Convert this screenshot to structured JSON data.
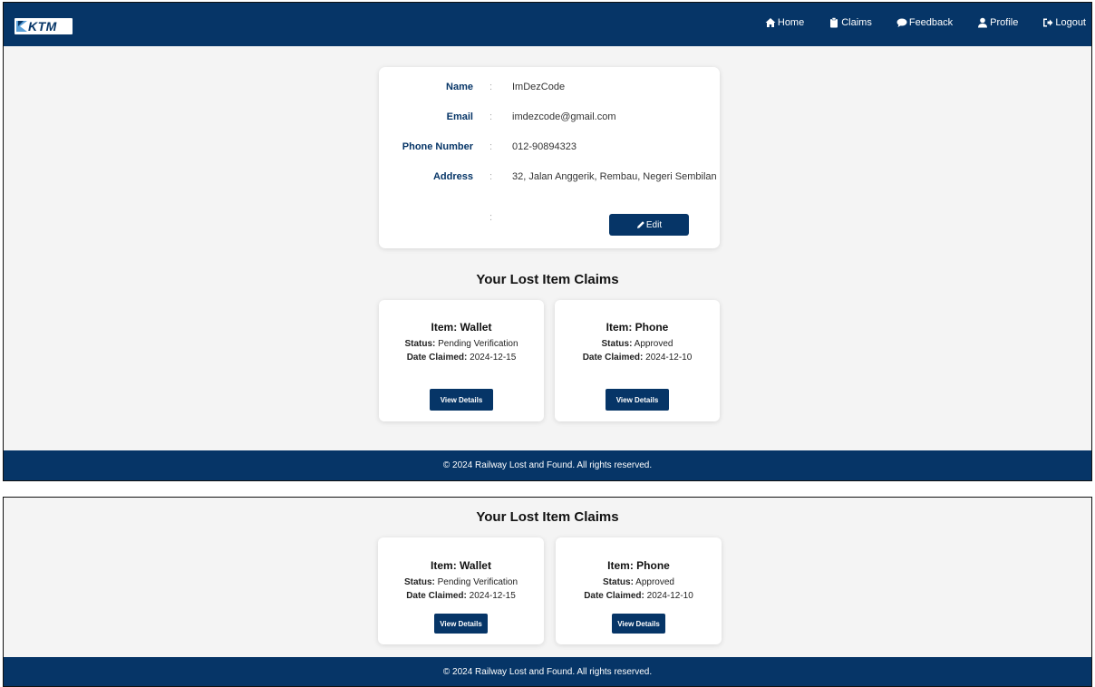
{
  "navbar": {
    "logo_text": "KTM",
    "items": [
      {
        "label": "Home",
        "icon": "home-icon"
      },
      {
        "label": "Claims",
        "icon": "clipboard-icon"
      },
      {
        "label": "Feedback",
        "icon": "speech-bubble-icon"
      },
      {
        "label": "Profile",
        "icon": "user-icon"
      },
      {
        "label": "Logout",
        "icon": "logout-icon"
      }
    ]
  },
  "profile": {
    "fields": [
      {
        "label": "Name",
        "value": "ImDezCode"
      },
      {
        "label": "Email",
        "value": "imdezcode@gmail.com"
      },
      {
        "label": "Phone Number",
        "value": "012-90894323"
      },
      {
        "label": "Address",
        "value": "32, Jalan Anggerik, Rembau, Negeri Sembilan"
      }
    ],
    "separator": ":",
    "edit_label": "Edit"
  },
  "claims": {
    "title": "Your Lost Item Claims",
    "status_label": "Status:",
    "date_label": "Date Claimed:",
    "button_label": "View Details",
    "items": [
      {
        "item": "Item: Wallet",
        "status": "Pending Verification",
        "date": "2024-12-15"
      },
      {
        "item": "Item: Phone",
        "status": "Approved",
        "date": "2024-12-10"
      }
    ]
  },
  "footer": {
    "text": "© 2024 Railway Lost and Found. All rights reserved."
  },
  "colors": {
    "primary": "#063567",
    "background": "#f4f4f4",
    "card": "#ffffff"
  }
}
